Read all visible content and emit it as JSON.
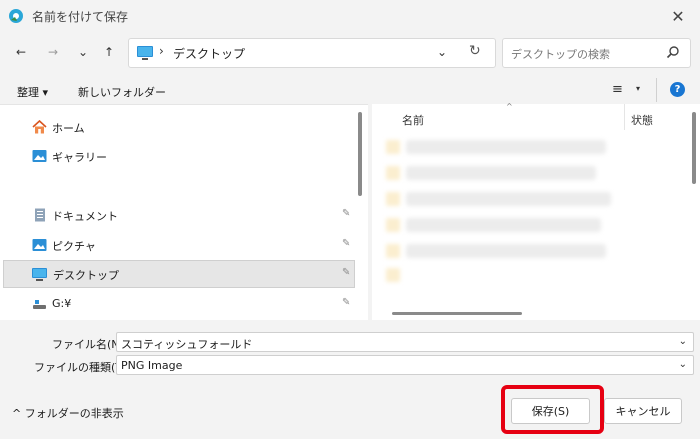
{
  "window": {
    "title": "名前を付けて保存",
    "close_glyph": "✕"
  },
  "nav": {
    "back": "←",
    "forward": "→",
    "recent": "⌄",
    "up": "↑"
  },
  "address": {
    "separator": "›",
    "path": "デスクトップ",
    "dropdown": "⌄",
    "refresh": "↻"
  },
  "search": {
    "placeholder": "デスクトップの検索"
  },
  "toolbar": {
    "organize": "整理 ▾",
    "new_folder": "新しいフォルダー",
    "view": "≡",
    "view_dropdown": "▾",
    "help": "?"
  },
  "sidebar": {
    "items": [
      {
        "label": "ホーム",
        "pinned": false
      },
      {
        "label": "ギャラリー",
        "pinned": false
      },
      {
        "label": "ドキュメント",
        "pinned": true
      },
      {
        "label": "ピクチャ",
        "pinned": true
      },
      {
        "label": "デスクトップ",
        "pinned": true,
        "selected": true
      },
      {
        "label": "G:¥",
        "pinned": true
      }
    ],
    "pin_glyph": "✎"
  },
  "file_list": {
    "col_name": "名前",
    "col_state": "状態",
    "sort_glyph": "^"
  },
  "form": {
    "filename_label": "ファイル名(N):",
    "filename_value": "スコティッシュフォールド",
    "filetype_label": "ファイルの種類(T):",
    "filetype_value": "PNG Image",
    "dropdown_glyph": "⌄"
  },
  "footer": {
    "hide_folders": "^ フォルダーの非表示",
    "save": "保存(S)",
    "cancel": "キャンセル"
  },
  "colors": {
    "accent": "#1976d2",
    "highlight": "#e60012"
  }
}
